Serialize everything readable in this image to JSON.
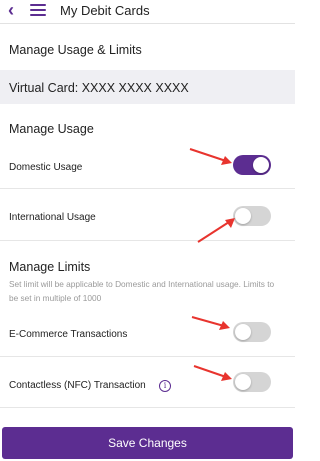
{
  "header": {
    "title": "My Debit Cards"
  },
  "sections": {
    "limits_heading": "Manage Usage & Limits",
    "virtual_card": "Virtual Card: XXXX XXXX XXXX",
    "manage_usage": "Manage Usage",
    "manage_limits": "Manage Limits",
    "limits_note": "Set limit will be applicable to Domestic and International usage. Limits to be set in multiple of 1000"
  },
  "toggles": {
    "domestic": {
      "label": "Domestic Usage",
      "on": true
    },
    "international": {
      "label": "International Usage",
      "on": false
    },
    "ecommerce": {
      "label": "E-Commerce Transactions",
      "on": false
    },
    "contactless": {
      "label": "Contactless (NFC) Transaction",
      "on": false
    }
  },
  "info_icon_glyph": "i",
  "footer": {
    "save_label": "Save Changes"
  },
  "colors": {
    "accent": "#5c2d91",
    "annotation_arrow": "#e8342e",
    "toggle_off": "#d5d5d5"
  }
}
